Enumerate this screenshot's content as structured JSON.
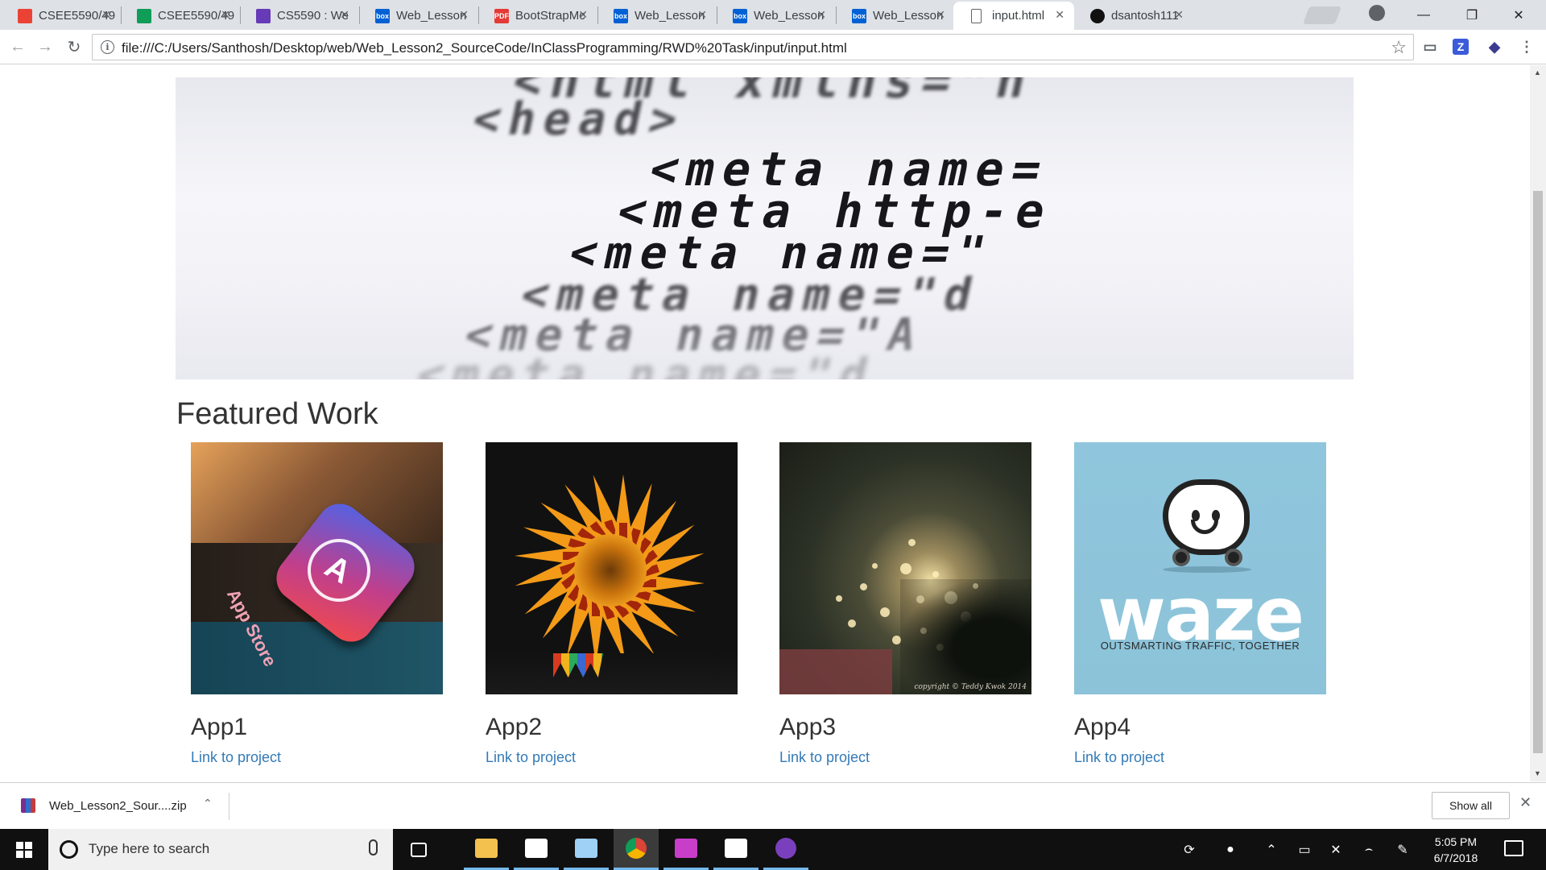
{
  "browser": {
    "tabs": [
      {
        "title": "CSEE5590/49",
        "favicon": "gmail-icon",
        "color": "#ea4335"
      },
      {
        "title": "CSEE5590/49",
        "favicon": "sheets-icon",
        "color": "#0f9d58"
      },
      {
        "title": "CS5590 : We",
        "favicon": "forms-icon",
        "color": "#673ab7"
      },
      {
        "title": "Web_Lesson",
        "favicon": "box-icon",
        "color": "#0061d5"
      },
      {
        "title": "BootStrapMc",
        "favicon": "pdf-icon",
        "color": "#e53935"
      },
      {
        "title": "Web_Lesson",
        "favicon": "box-icon",
        "color": "#0061d5"
      },
      {
        "title": "Web_Lesson",
        "favicon": "box-icon",
        "color": "#0061d5"
      },
      {
        "title": "Web_Lesson",
        "favicon": "box-icon",
        "color": "#0061d5"
      },
      {
        "title": "input.html",
        "favicon": "document-icon",
        "color": "#5f6368"
      },
      {
        "title": "dsantosh111",
        "favicon": "github-icon",
        "color": "#111111"
      }
    ],
    "active_tab_index": 8,
    "url": "file:///C:/Users/Santhosh/Desktop/web/Web_Lesson2_SourceCode/InClassProgramming/RWD%20Task/input/input.html",
    "favicon_labels": {
      "box": "box",
      "pdf": "PDF"
    },
    "extensions": [
      {
        "name": "cast-icon",
        "glyph": "▭",
        "color": "#5f6368"
      },
      {
        "name": "zotero-icon",
        "glyph": "Z",
        "color": "#3b5bdb"
      },
      {
        "name": "extension-icon",
        "glyph": "◆",
        "color": "#3b3b8f"
      },
      {
        "name": "menu-icon",
        "glyph": "⋮",
        "color": "#5f6368"
      }
    ]
  },
  "page": {
    "hero_lines": [
      "<html  xmlns=\"h",
      "<head>",
      "<meta  name=",
      "<meta  http-e",
      "<meta  name=\"",
      "<meta  name=\"d",
      "<meta  name=\"A",
      "<meta  name=\"d"
    ],
    "section_title": "Featured Work",
    "projects": [
      {
        "name": "App1",
        "link": "Link to project"
      },
      {
        "name": "App2",
        "link": "Link to project"
      },
      {
        "name": "App3",
        "link": "Link to project"
      },
      {
        "name": "App4",
        "link": "Link to project"
      }
    ],
    "thumb_text": {
      "app1": "App Store",
      "app3_copyright": "copyright © Teddy Kwok 2014",
      "app4_wordmark": "waze",
      "app4_tagline": "OUTSMARTING TRAFFIC, TOGETHER"
    }
  },
  "downloads": {
    "file_name": "Web_Lesson2_Sour....zip",
    "show_all": "Show all"
  },
  "taskbar": {
    "search_placeholder": "Type here to search",
    "time": "5:05 PM",
    "date": "6/7/2018",
    "pinned": [
      {
        "name": "task-view-icon",
        "color": "#ffffff"
      },
      {
        "name": "file-explorer-icon",
        "color": "#f2c14e"
      },
      {
        "name": "store-icon",
        "color": "#ffffff"
      },
      {
        "name": "paint-icon",
        "color": "#9fd0f5"
      },
      {
        "name": "chrome-icon",
        "color": "#4285f4"
      },
      {
        "name": "pen-app-icon",
        "color": "#c83ec9"
      },
      {
        "name": "mail-icon",
        "color": "#ffffff"
      },
      {
        "name": "github-desktop-icon",
        "color": "#7a3fbd"
      }
    ]
  }
}
